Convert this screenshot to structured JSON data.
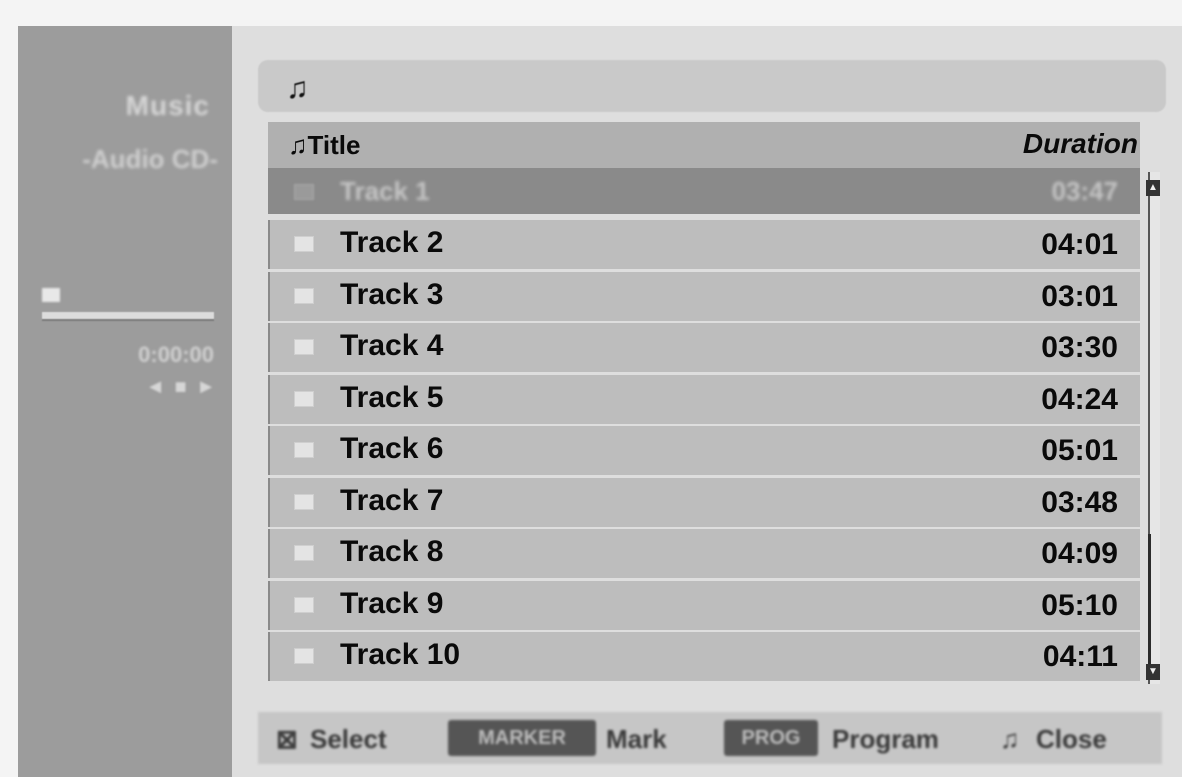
{
  "sidebar": {
    "title": "Music",
    "subtitle": "-Audio CD-",
    "time": "0:00:00",
    "controls": "◄ ■ ►"
  },
  "path": {
    "icon": "music-note-icon",
    "glyph": "♫"
  },
  "list": {
    "header_title": "Title",
    "header_icon": "♫",
    "header_duration": "Duration",
    "tracks": [
      {
        "title": "Track 1",
        "duration": "03:47"
      },
      {
        "title": "Track 2",
        "duration": "04:01"
      },
      {
        "title": "Track 3",
        "duration": "03:01"
      },
      {
        "title": "Track 4",
        "duration": "03:30"
      },
      {
        "title": "Track 5",
        "duration": "04:24"
      },
      {
        "title": "Track 6",
        "duration": "05:01"
      },
      {
        "title": "Track 7",
        "duration": "03:48"
      },
      {
        "title": "Track 8",
        "duration": "04:09"
      },
      {
        "title": "Track 9",
        "duration": "05:10"
      },
      {
        "title": "Track 10",
        "duration": "04:11"
      }
    ]
  },
  "footer": {
    "select_icon": "⊠",
    "select_label": "Select",
    "mark_key": "MARKER",
    "mark_label": "Mark",
    "program_key": "PROG",
    "program_label": "Program",
    "close_icon": "♫",
    "close_label": "Close"
  }
}
